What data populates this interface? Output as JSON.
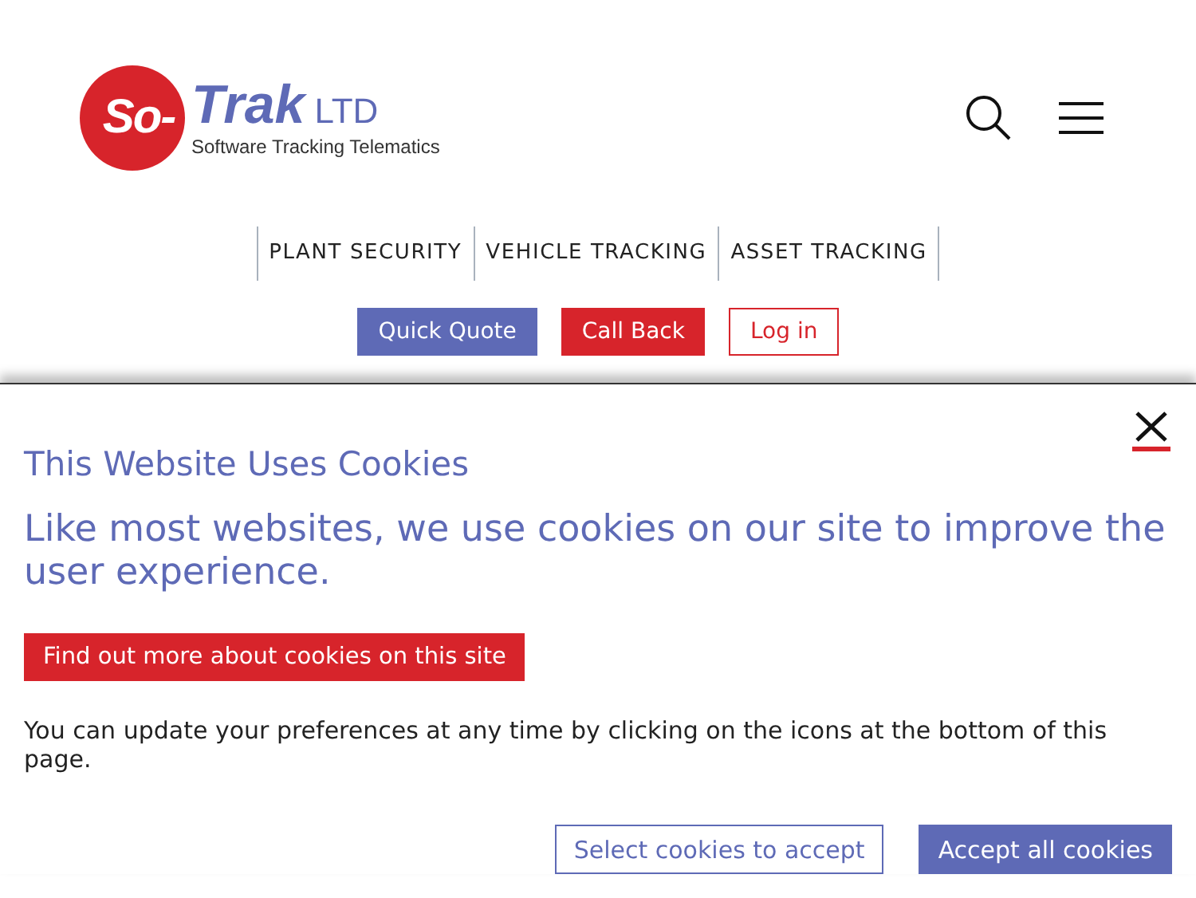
{
  "logo": {
    "mark": "So-",
    "name": "Trak",
    "suffix": "LTD",
    "tagline": "Software Tracking Telematics"
  },
  "nav": [
    {
      "label": "PLANT SECURITY"
    },
    {
      "label": "VEHICLE TRACKING"
    },
    {
      "label": "ASSET TRACKING"
    }
  ],
  "actions": [
    {
      "label": "Quick Quote",
      "kind": "primary"
    },
    {
      "label": "Call Back",
      "kind": "danger"
    },
    {
      "label": "Log in",
      "kind": "outline"
    }
  ],
  "cookie_banner": {
    "title": "This Website Uses Cookies",
    "lead": "Like most websites, we use cookies on our site to improve the user experience.",
    "more_button": "Find out more about cookies on this site",
    "note": "You can update your preferences at any time by clicking on the icons at the bottom of this page.",
    "buttons": [
      {
        "label": "Select cookies to accept",
        "kind": "outline"
      },
      {
        "label": "Accept all cookies",
        "kind": "primary"
      }
    ]
  }
}
